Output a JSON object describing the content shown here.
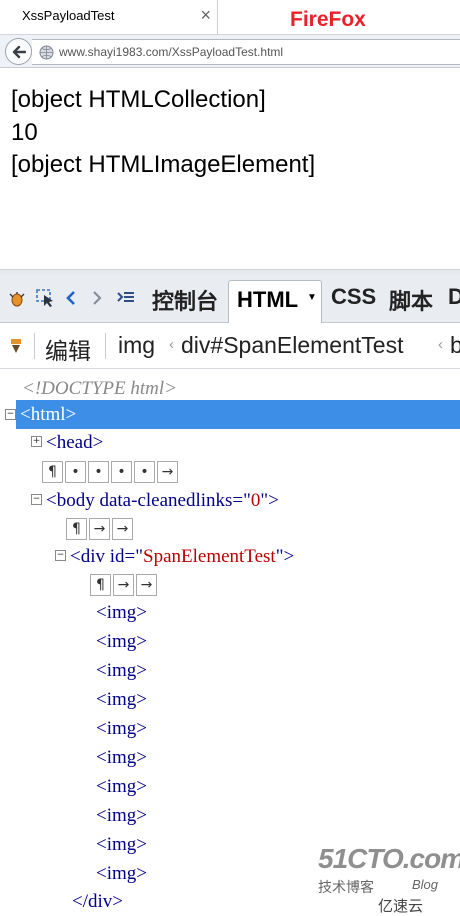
{
  "browser": {
    "tab_title": "XssPayloadTest",
    "tab_close": "×",
    "label": "FireFox",
    "url": "www.shayi1983.com/XssPayloadTest.html"
  },
  "page": {
    "lines": [
      "[object HTMLCollection]",
      "10",
      "[object HTMLImageElement]"
    ]
  },
  "firebug": {
    "tabs": {
      "console": "控制台",
      "html": "HTML",
      "css": "CSS",
      "script": "脚本",
      "more": "D"
    },
    "edit": "编辑",
    "breadcrumbs": [
      "img",
      "div#SpanElementTest",
      "b"
    ],
    "tree": {
      "doctype": "<!DOCTYPE html>",
      "html_open": "<html>",
      "head": "<head>",
      "body_open_tag": "<body data-cleanedlinks=\"",
      "body_attr_val": "0",
      "body_close_bracket": "\">",
      "div_open_tag": "<div id=\"",
      "div_attr_val": "SpanElementTest",
      "div_close_bracket": "\">",
      "img": "<img>",
      "img_count": 10,
      "div_close": "</div>",
      "ws_head": [
        "¶",
        "•",
        "•",
        "•",
        "•",
        "→"
      ],
      "ws_body": [
        "¶",
        "→",
        "→"
      ],
      "ws_div": [
        "¶",
        "→",
        "→"
      ]
    }
  },
  "watermark": {
    "logo": "51CTO.com",
    "sub": "技术博客",
    "blog": "Blog",
    "yun": "亿速云"
  }
}
